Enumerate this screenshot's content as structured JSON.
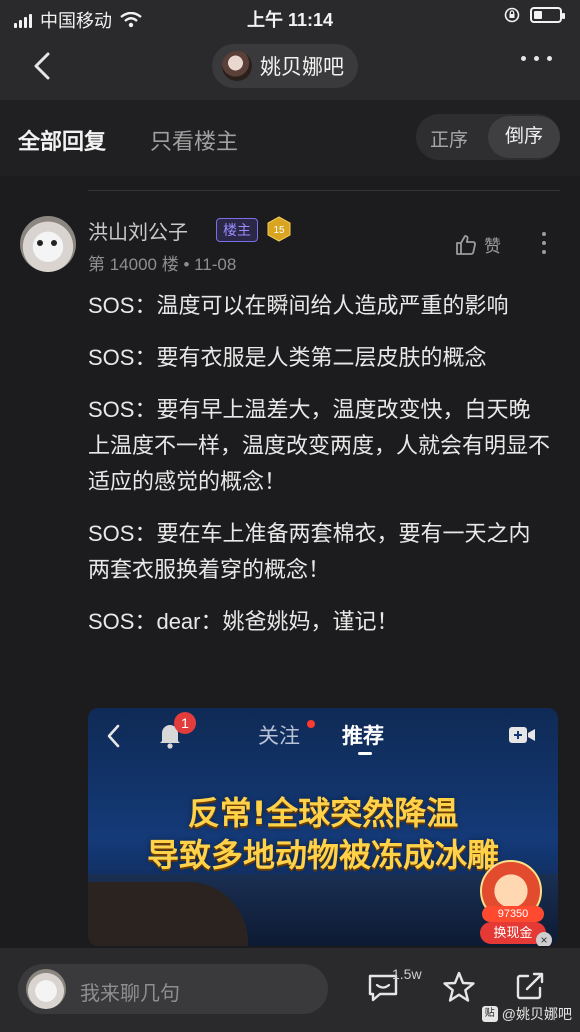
{
  "status": {
    "carrier": "中国移动",
    "time": "上午 11:14"
  },
  "nav": {
    "forum_name": "姚贝娜吧"
  },
  "tabs": {
    "all": "全部回复",
    "op_only": "只看楼主",
    "sort_asc": "正序",
    "sort_desc": "倒序",
    "active_sort": "倒序"
  },
  "post": {
    "author": "洪山刘公子",
    "op_badge": "楼主",
    "level": "15",
    "meta": "第 14000 楼 • 11-08",
    "like_label": "赞",
    "paragraphs": [
      "SOS：温度可以在瞬间给人造成严重的影响",
      "SOS：要有衣服是人类第二层皮肤的概念",
      "SOS：要有早上温差大，温度改变快，白天晚上温度不一样，温度改变两度，人就会有明显不适应的感觉的概念！",
      "SOS：要在车上准备两套棉衣，要有一天之内两套衣服换着穿的概念！",
      "SOS：dear：姚爸姚妈，谨记！"
    ]
  },
  "embed": {
    "badge": "1",
    "follow": "关注",
    "recommend": "推荐",
    "headline_1": "反常!全球突然降温",
    "headline_2": "导致多地动物被冻成冰雕",
    "coins": "97350",
    "cash_button": "换现金"
  },
  "bottom": {
    "placeholder": "我来聊几句",
    "comment_count": "1.5w",
    "watermark": "@姚贝娜吧"
  },
  "colors": {
    "background": "#1c1c1e",
    "op_badge": "#7c6ee8",
    "headline": "#ffd24a"
  }
}
